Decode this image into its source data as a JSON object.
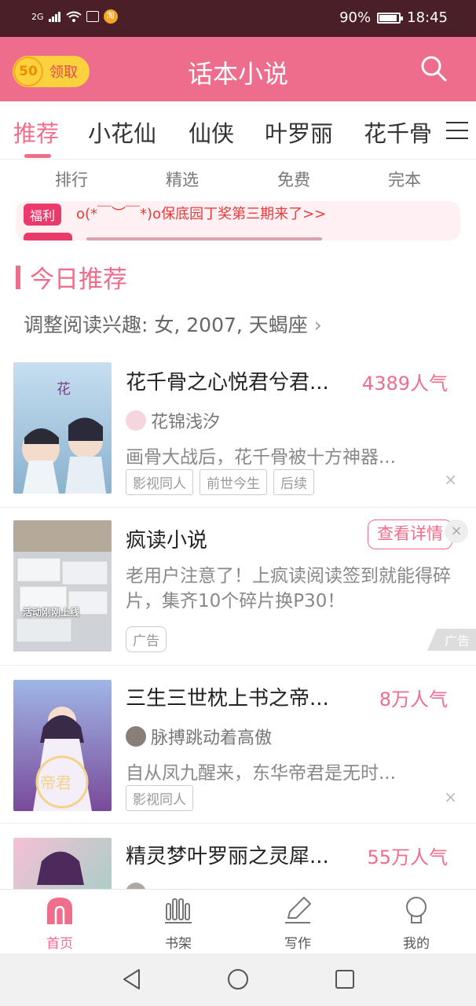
{
  "status_bar": {
    "signal": "2G",
    "battery": "90%",
    "battery_level": 0.9,
    "time": "18:45",
    "icons": [
      "signal-icon",
      "wifi-icon",
      "activity-icon",
      "taobao-icon"
    ]
  },
  "header": {
    "coin_value": "50",
    "coin_label": "领取",
    "title": "话本小说",
    "search_icon": "search-icon"
  },
  "category_tabs": [
    {
      "label": "推荐",
      "active": true
    },
    {
      "label": "小花仙",
      "active": false
    },
    {
      "label": "仙侠",
      "active": false
    },
    {
      "label": "叶罗丽",
      "active": false
    },
    {
      "label": "花千骨",
      "active": false
    }
  ],
  "quick_nav": [
    "排行",
    "精选",
    "免费",
    "完本"
  ],
  "notice": {
    "badge": "福利",
    "text": "o(*￣︶￣*)o保底园丁奖第三期来了>>"
  },
  "section": {
    "title": "今日推荐",
    "interest": "调整阅读兴趣: 女, 2007, 天蝎座",
    "interest_arrow": "›"
  },
  "feed": [
    {
      "title": "花千骨之心悦君兮君...",
      "popularity": "4389人气",
      "author": "花锦浅汐",
      "desc": "画骨大战后，花千骨被十方神器...",
      "tags": [
        "影视同人",
        "前世今生",
        "后续"
      ],
      "close": "×"
    },
    {
      "title": "疯读小说",
      "button": "查看详情",
      "close": "×",
      "desc": "老用户注意了！上疯读阅读签到就能得碎片，集齐10个碎片换P30！",
      "cover_caption": "活动刚刚上线",
      "tag": "广告",
      "ad_mark": "广告"
    },
    {
      "title": "三生三世枕上书之帝...",
      "popularity": "8万人气",
      "author": "脉搏跳动着高傲",
      "desc": "自从凤九醒来，东华帝君是无时...",
      "tags": [
        "影视同人"
      ],
      "close": "×"
    },
    {
      "title": "精灵梦叶罗丽之灵犀...",
      "popularity": "55万人气"
    }
  ],
  "bottom_nav": [
    {
      "label": "首页",
      "icon": "home-icon",
      "active": true
    },
    {
      "label": "书架",
      "icon": "bookshelf-icon",
      "active": false
    },
    {
      "label": "写作",
      "icon": "pencil-icon",
      "active": false
    },
    {
      "label": "我的",
      "icon": "profile-icon",
      "active": false
    }
  ],
  "system_nav": [
    "back-icon",
    "home-circle-icon",
    "recents-icon"
  ],
  "colors": {
    "accent": "#ee6e8b",
    "header": "#ef6d8c",
    "status_bar": "#4a1f28",
    "coin": "#fbd23d"
  }
}
